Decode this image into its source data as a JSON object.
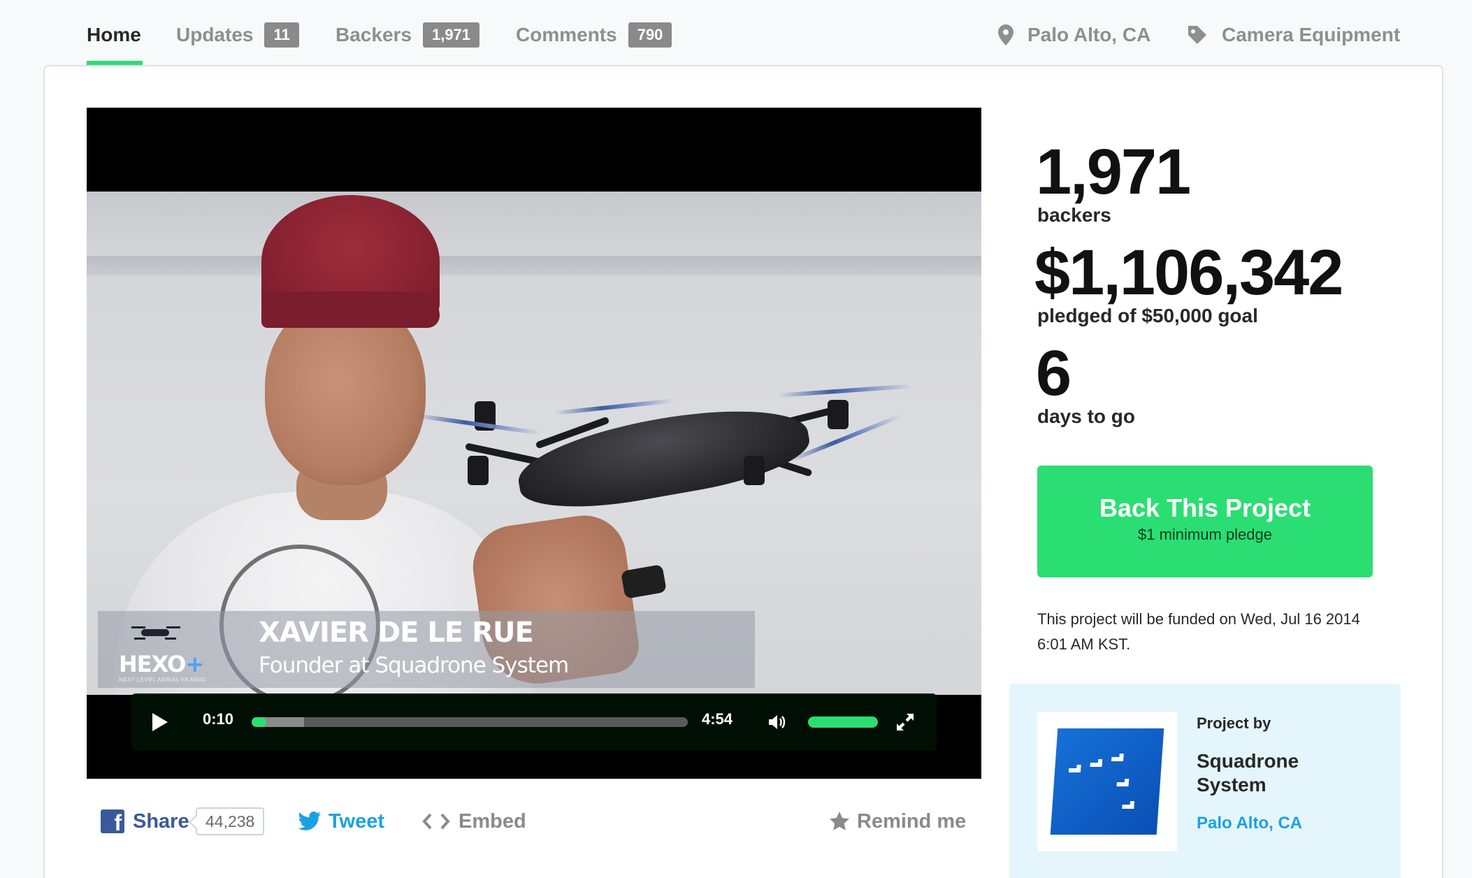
{
  "nav": {
    "tabs": [
      {
        "label": "Home"
      },
      {
        "label": "Updates",
        "count": "11"
      },
      {
        "label": "Backers",
        "count": "1,971"
      },
      {
        "label": "Comments",
        "count": "790"
      }
    ],
    "location": "Palo Alto, CA",
    "category": "Camera Equipment"
  },
  "video": {
    "lower_third": {
      "logo_text": "HEXO",
      "logo_plus": "+",
      "logo_tagline": "NEXT LEVEL AERIAL FILMING",
      "name": "XAVIER DE LE RUE",
      "role": "Founder at Squadrone System"
    },
    "controls": {
      "current_time": "0:10",
      "total_time": "4:54",
      "progress_fraction": 0.034,
      "buffered_fraction": 0.12,
      "volume_fraction": 1.0
    }
  },
  "share": {
    "share_label": "Share",
    "share_count": "44,238",
    "tweet_label": "Tweet",
    "embed_label": "Embed",
    "remind_label": "Remind me"
  },
  "stats": {
    "backers_value": "1,971",
    "backers_label": "backers",
    "pledged_value": "$1,106,342",
    "pledged_label": "pledged of $50,000 goal",
    "days_value": "6",
    "days_label": "days to go"
  },
  "cta": {
    "title": "Back This Project",
    "subtitle": "$1 minimum pledge"
  },
  "funding_note": "This project will be funded on Wed, Jul 16 2014 6:01 AM KST.",
  "creator": {
    "by_label": "Project by",
    "name": "Squadrone System",
    "location": "Palo Alto, CA"
  },
  "colors": {
    "accent_green": "#2bde73",
    "facebook_blue": "#3b5998",
    "twitter_blue": "#1ba1e2",
    "creator_bg": "#e5f5fc"
  },
  "icons": {
    "location": "map-pin-icon",
    "category": "tag-icon",
    "play": "play-icon",
    "volume": "volume-icon",
    "fullscreen": "fullscreen-icon",
    "facebook": "facebook-icon",
    "twitter": "twitter-icon",
    "embed": "code-icon",
    "remind": "star-icon"
  }
}
